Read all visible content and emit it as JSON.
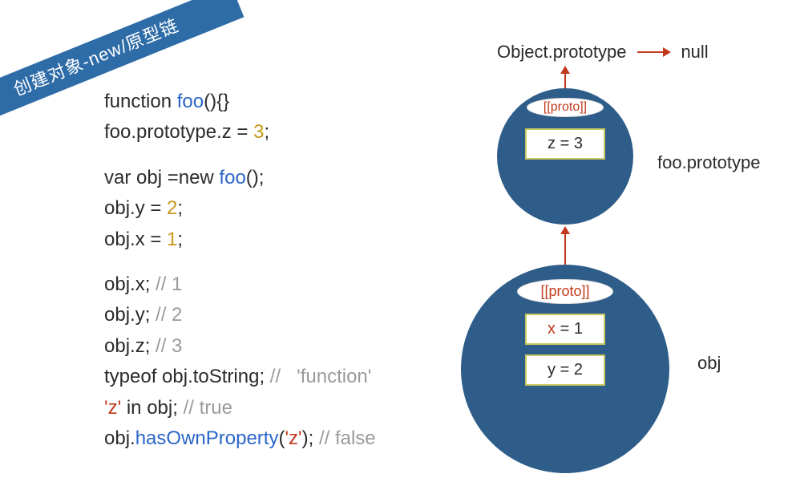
{
  "ribbon": {
    "title": "创建对象-new/原型链"
  },
  "code": {
    "l1_a": "function ",
    "l1_b": "foo",
    "l1_c": "(){}",
    "l2_a": "foo.prototype.z = ",
    "l2_b": "3",
    "l2_c": ";",
    "l3_a": "var obj =new ",
    "l3_b": "foo",
    "l3_c": "();",
    "l4_a": "obj.y = ",
    "l4_b": "2",
    "l4_c": ";",
    "l5_a": "obj.x = ",
    "l5_b": "1",
    "l5_c": ";",
    "l6_a": "obj.x; ",
    "l6_b": "// 1",
    "l7_a": "obj.y; ",
    "l7_b": "// 2",
    "l8_a": "obj.z; ",
    "l8_b": "// 3",
    "l9_a": "typeof obj.toString; ",
    "l9_b": "//   'function'",
    "l10_a": "'z'",
    "l10_b": " in obj; ",
    "l10_c": "// true",
    "l11_a": "obj.",
    "l11_b": "hasOwnProperty",
    "l11_c": "(",
    "l11_d": "'z'",
    "l11_e": "); ",
    "l11_f": "// false"
  },
  "diagram": {
    "top_left": "Object.prototype",
    "top_right": "null",
    "proto_label": "[[proto]]",
    "z_slot_key": "z",
    "z_slot_rest": " = 3",
    "x_slot_key": "x",
    "x_slot_rest": " = 1",
    "y_slot": "y = 2",
    "label_foo_proto": "foo.prototype",
    "label_obj": "obj"
  }
}
